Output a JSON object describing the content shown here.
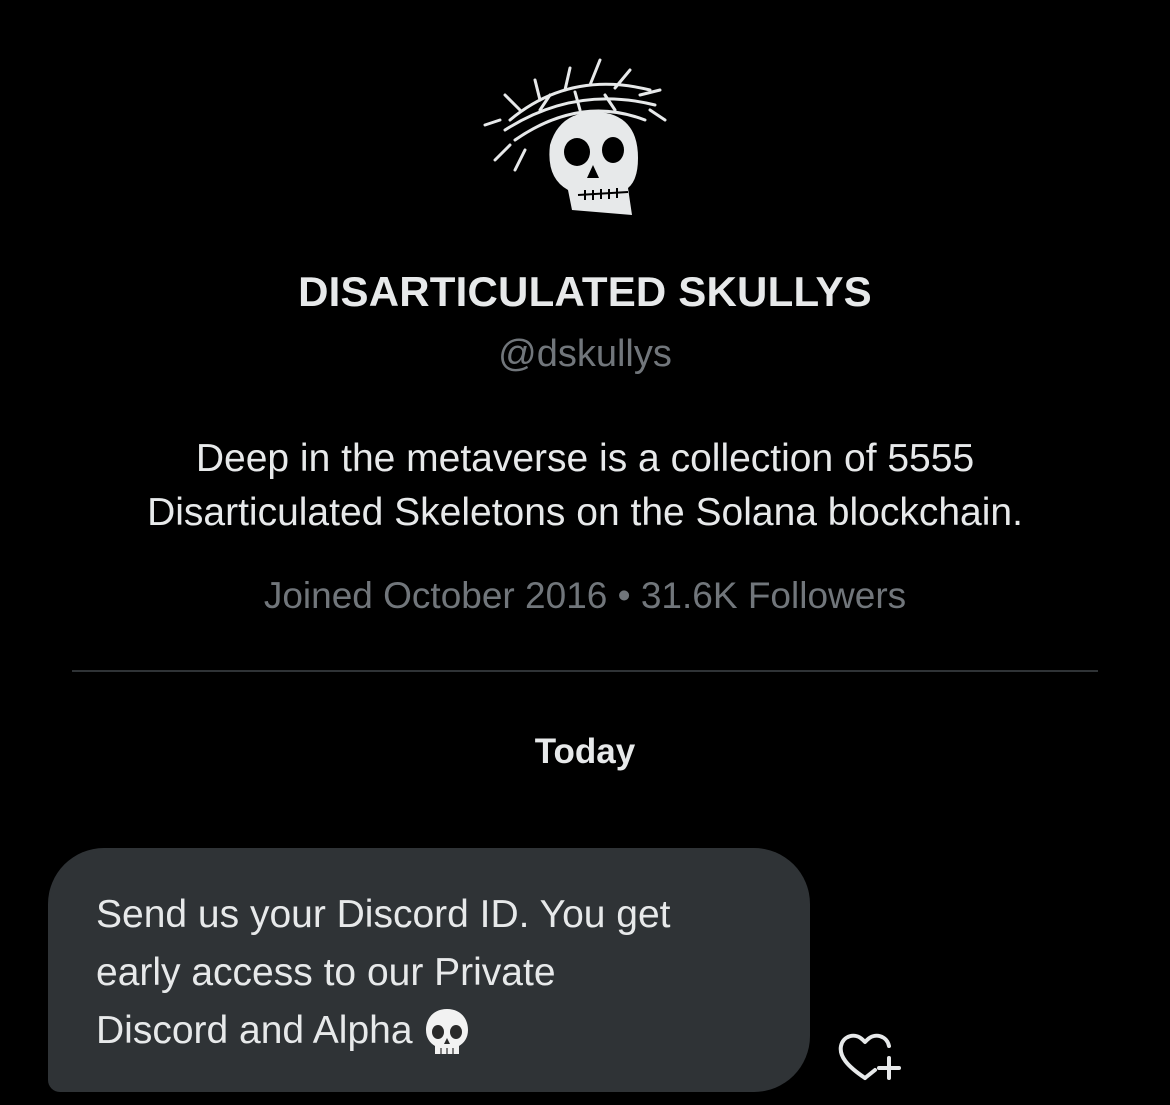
{
  "profile": {
    "avatar_icon": "crowned-skull-icon",
    "display_name": "DISARTICULATED SKULLYS",
    "handle": "@dskullys",
    "bio_line1": "Deep in the metaverse is a collection of 5555",
    "bio_line2": "Disarticulated Skeletons on the Solana blockchain.",
    "joined": "Joined October 2016",
    "separator": " • ",
    "followers": "31.6K Followers"
  },
  "conversation": {
    "date_label": "Today",
    "messages": [
      {
        "line1": "Send us your Discord ID. You get",
        "line2": "early access to our Private",
        "line3": "Discord and Alpha",
        "emoji_icon": "skull-emoji-icon",
        "react_icon": "heart-plus-icon"
      }
    ]
  },
  "colors": {
    "background": "#000000",
    "primary_text": "#e7e9ea",
    "secondary_text": "#71767b",
    "bubble": "#2f3336",
    "divider": "#2f3336"
  }
}
